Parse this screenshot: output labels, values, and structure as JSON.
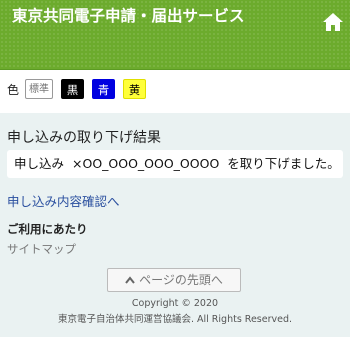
{
  "header": {
    "title": "東京共同電子申請・届出サービス",
    "home_icon": "home-icon"
  },
  "toolbar": {
    "color_label": "色",
    "buttons": [
      {
        "label": "標準",
        "color": "#ffffff"
      },
      {
        "label": "黒",
        "color": "#000000"
      },
      {
        "label": "青",
        "color": "#0000e0"
      },
      {
        "label": "黄",
        "color": "#ffff3a"
      }
    ]
  },
  "result": {
    "title": "申し込みの取り下げ結果",
    "message_prefix": "申し込み",
    "application_number": "×OO_OOO_OOO_OOOO",
    "message_suffix": "を取り下げました。"
  },
  "links": {
    "confirm": "申し込み内容確認へ"
  },
  "usage": {
    "title": "ご利用にあたり",
    "sitemap": "サイトマップ"
  },
  "pagetop": {
    "label": "ページの先頭へ"
  },
  "footer": {
    "copyright_line1": "Copyright © 2020",
    "copyright_line2": "東京電子自治体共同運営協議会. All Rights Reserved."
  },
  "colors": {
    "header_green": "#6cab2d",
    "main_bg": "#eaf2f2",
    "link_blue": "#2a4f9f"
  }
}
